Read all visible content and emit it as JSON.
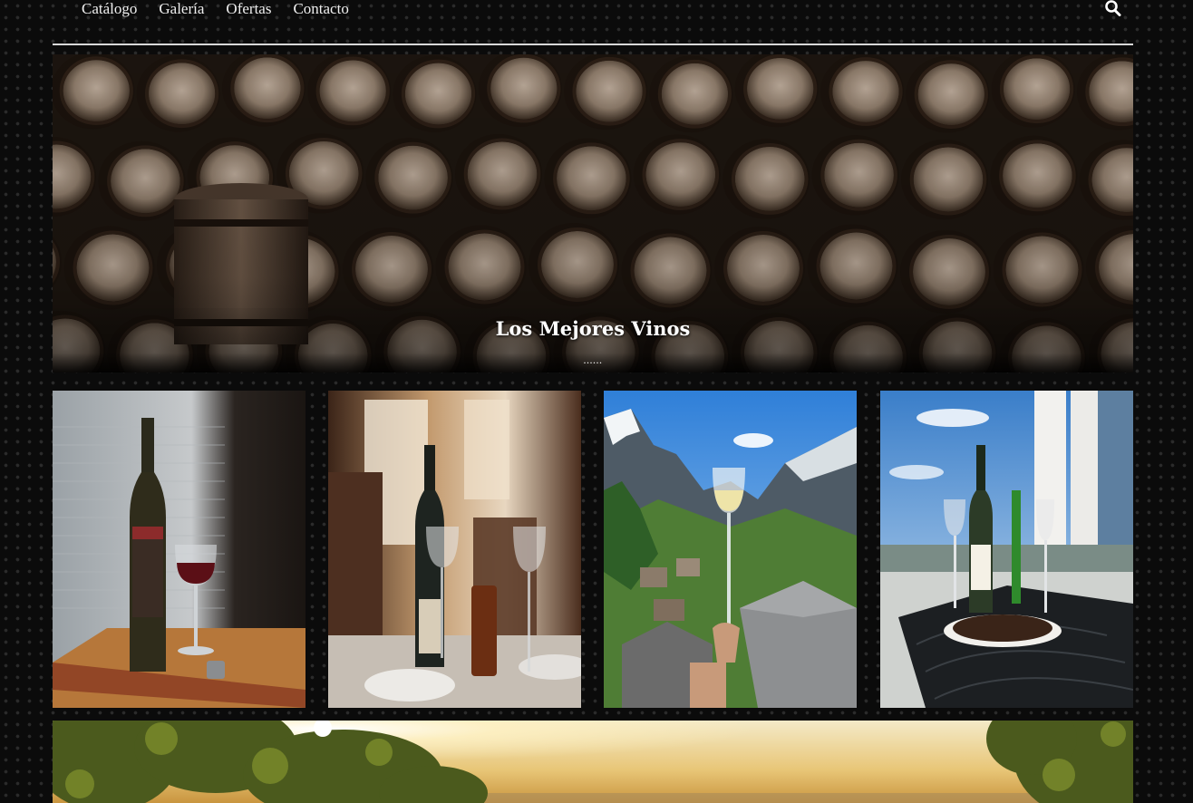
{
  "nav": {
    "items": [
      {
        "label": "Catálogo"
      },
      {
        "label": "Galería"
      },
      {
        "label": "Ofertas"
      },
      {
        "label": "Contacto"
      }
    ],
    "search_icon": "search-icon"
  },
  "hero": {
    "title": "Los Mejores Vinos",
    "dots": "......"
  },
  "gallery": {
    "images": [
      {
        "name": "wine-bottle-glass-photo"
      },
      {
        "name": "restaurant-table-wine-photo"
      },
      {
        "name": "mountain-village-wine-glass-photo"
      },
      {
        "name": "terrace-wine-mussels-photo"
      }
    ]
  },
  "banner": {
    "name": "vineyard-sunset-photo"
  },
  "colors": {
    "background": "#0b0b0b",
    "nav_text": "#efefef",
    "divider": "#d9d9d9",
    "hero_text": "#ffffff"
  }
}
